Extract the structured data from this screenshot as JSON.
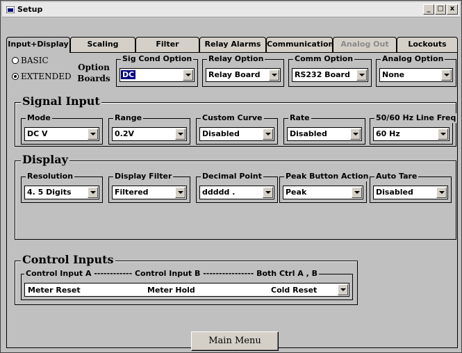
{
  "window": {
    "title": "Setup",
    "minimize": "_",
    "maximize": "□",
    "close": "x"
  },
  "tabs": [
    {
      "label": "Input+Display",
      "active": true,
      "enabled": true
    },
    {
      "label": "Scaling",
      "active": false,
      "enabled": true
    },
    {
      "label": "Filter",
      "active": false,
      "enabled": true
    },
    {
      "label": "Relay Alarms",
      "active": false,
      "enabled": true
    },
    {
      "label": "Communication",
      "active": false,
      "enabled": true
    },
    {
      "label": "Analog Out",
      "active": false,
      "enabled": false
    },
    {
      "label": "Lockouts",
      "active": false,
      "enabled": true
    }
  ],
  "mode_radio": {
    "basic": "BASIC",
    "extended": "EXTENDED",
    "selected": "EXTENDED"
  },
  "option_boards": {
    "label_line1": "Option",
    "label_line2": "Boards",
    "sig_cond": {
      "label": "Sig Cond Option",
      "value": "DC"
    },
    "relay": {
      "label": "Relay Option",
      "value": "Relay Board"
    },
    "comm": {
      "label": "Comm Option",
      "value": "RS232 Board"
    },
    "analog": {
      "label": "Analog Option",
      "value": "None"
    }
  },
  "signal_input": {
    "title": "Signal Input",
    "mode": {
      "label": "Mode",
      "value": "DC V"
    },
    "range": {
      "label": "Range",
      "value": "0.2V"
    },
    "custom_curve": {
      "label": "Custom Curve",
      "value": "Disabled"
    },
    "rate": {
      "label": "Rate",
      "value": "Disabled"
    },
    "line_freq": {
      "label": "50/60 Hz Line Freq",
      "value": "60 Hz"
    }
  },
  "display": {
    "title": "Display",
    "resolution": {
      "label": "Resolution",
      "value": "4. 5 Digits"
    },
    "display_filter": {
      "label": "Display Filter",
      "value": "Filtered"
    },
    "decimal_point": {
      "label": "Decimal Point",
      "value": "ddddd ."
    },
    "peak_button": {
      "label": "Peak Button Action",
      "value": "Peak"
    },
    "auto_tare": {
      "label": "Auto Tare",
      "value": "Disabled"
    }
  },
  "control_inputs": {
    "title": "Control Inputs",
    "header": "Control Input A ------------ Control Input B ---------------- Both Ctrl A , B",
    "input_a": "Meter Reset",
    "input_b": "Meter Hold",
    "both": "Cold Reset"
  },
  "footer": {
    "main_menu": "Main Menu"
  }
}
